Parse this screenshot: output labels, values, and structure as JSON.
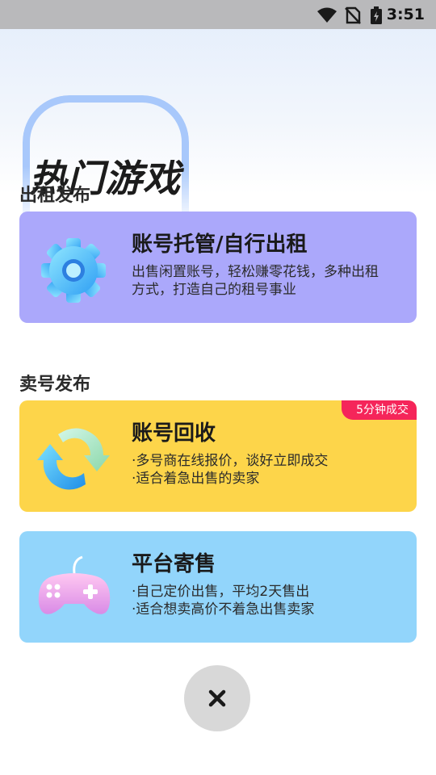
{
  "status_bar": {
    "time": "3:51",
    "icons": [
      "wifi-icon",
      "no-sim-icon",
      "battery-charging-icon"
    ]
  },
  "hero": {
    "title": "热门游戏"
  },
  "sections": {
    "rent": {
      "label": "出租发布"
    },
    "sell": {
      "label": "卖号发布"
    }
  },
  "cards": {
    "rent": {
      "title": "账号托管/自行出租",
      "desc": "出售闲置账号，轻松赚零花钱，多种出租方式，打造自己的租号事业",
      "icon": "gear-icon",
      "color": "#aba8fb"
    },
    "recycle": {
      "title": "账号回收",
      "desc_line1": "·多号商在线报价，谈好立即成交",
      "desc_line2": "·适合着急出售的卖家",
      "badge": "5分钟成交",
      "icon": "recycle-arrows-icon",
      "color": "#fdd54a"
    },
    "consign": {
      "title": "平台寄售",
      "desc_line1": "·自己定价出售，平均2天售出",
      "desc_line2": "·适合想卖高价不着急出售卖家",
      "icon": "gamepad-icon",
      "color": "#92d5fb"
    }
  },
  "close_button": {
    "icon": "close-icon"
  }
}
